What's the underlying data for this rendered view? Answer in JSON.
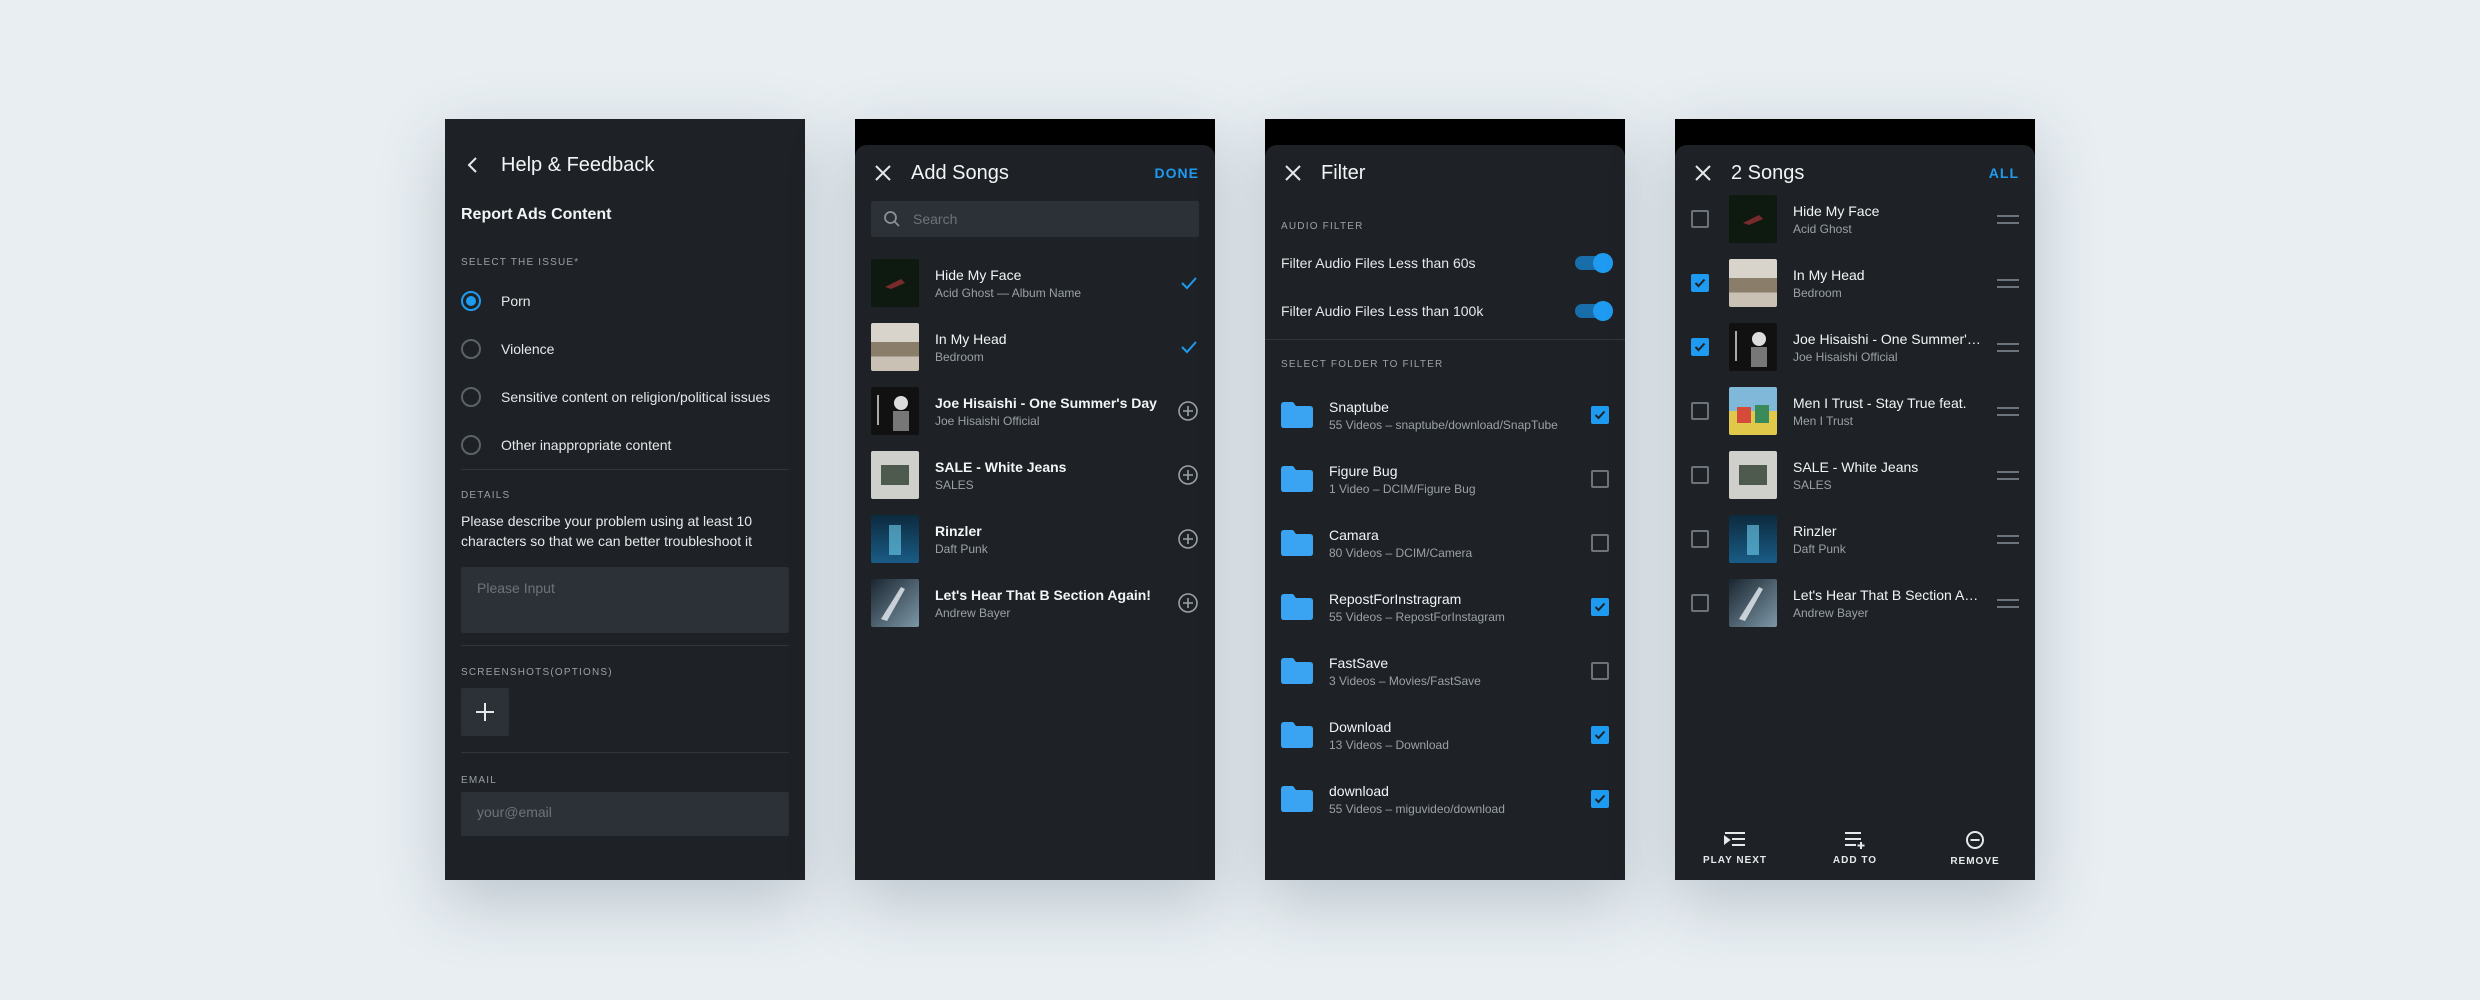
{
  "help": {
    "title": "Help & Feedback",
    "subtitle": "Report Ads Content",
    "issue_label": "SELECT THE ISSUE*",
    "options": [
      "Porn",
      "Violence",
      "Sensitive content on religion/political issues",
      "Other inappropriate content"
    ],
    "selected_index": 0,
    "details_label": "DETAILS",
    "details_text": "Please describe your problem using at least 10 characters so that we can better troubleshoot it",
    "details_placeholder": "Please Input",
    "screenshots_label": "SCREENSHOTS(OPTIONS)",
    "email_label": "EMAIL",
    "email_placeholder": "your@email"
  },
  "add_songs": {
    "title": "Add Songs",
    "done_label": "DONE",
    "search_placeholder": "Search",
    "songs": [
      {
        "title": "Hide My Face",
        "sub": "Acid Ghost — Album Name",
        "added": true
      },
      {
        "title": "In My Head",
        "sub": "Bedroom",
        "added": true
      },
      {
        "title": "Joe Hisaishi - One Summer's Day",
        "sub": "Joe Hisaishi Official",
        "added": false
      },
      {
        "title": "SALE - White Jeans",
        "sub": "SALES",
        "added": false
      },
      {
        "title": "Rinzler",
        "sub": "Daft Punk",
        "added": false
      },
      {
        "title": "Let's Hear That B Section Again!",
        "sub": "Andrew Bayer",
        "added": false
      }
    ]
  },
  "filter": {
    "title": "Filter",
    "audio_label": "AUDIO FILTER",
    "toggles": [
      {
        "label": "Filter Audio Files Less than 60s",
        "on": true
      },
      {
        "label": "Filter Audio Files Less than 100k",
        "on": true
      }
    ],
    "folder_label": "SELECT FOLDER TO FILTER",
    "folders": [
      {
        "name": "Snaptube",
        "sub": "55 Videos – snaptube/download/SnapTube",
        "checked": true
      },
      {
        "name": "Figure Bug",
        "sub": "1 Video – DCIM/Figure Bug",
        "checked": false
      },
      {
        "name": "Camara",
        "sub": "80 Videos – DCIM/Camera",
        "checked": false
      },
      {
        "name": "RepostForInstragram",
        "sub": "55 Videos – RepostForInstagram",
        "checked": true
      },
      {
        "name": "FastSave",
        "sub": "3 Videos – Movies/FastSave",
        "checked": false
      },
      {
        "name": "Download",
        "sub": "13 Videos – Download",
        "checked": true
      },
      {
        "name": "download",
        "sub": "55 Videos – miguvideo/download",
        "checked": true
      }
    ]
  },
  "selection": {
    "title": "2 Songs",
    "all_label": "ALL",
    "songs": [
      {
        "title": "Hide My Face",
        "sub": "Acid Ghost",
        "checked": false
      },
      {
        "title": "In My Head",
        "sub": "Bedroom",
        "checked": true
      },
      {
        "title": "Joe Hisaishi - One Summer's Day",
        "sub": "Joe Hisaishi Official",
        "checked": true
      },
      {
        "title": "Men I Trust - Stay True feat.",
        "sub": "Men I Trust",
        "checked": false
      },
      {
        "title": "SALE - White Jeans",
        "sub": "SALES",
        "checked": false
      },
      {
        "title": "Rinzler",
        "sub": "Daft Punk",
        "checked": false
      },
      {
        "title": "Let's Hear That B Section Again!",
        "sub": "Andrew Bayer",
        "checked": false
      }
    ],
    "actions": [
      "PLAY NEXT",
      "ADD TO",
      "REMOVE"
    ]
  },
  "colors": {
    "accent": "#1e9bf0",
    "panel": "#1e2226",
    "background": "#e8eef2"
  }
}
